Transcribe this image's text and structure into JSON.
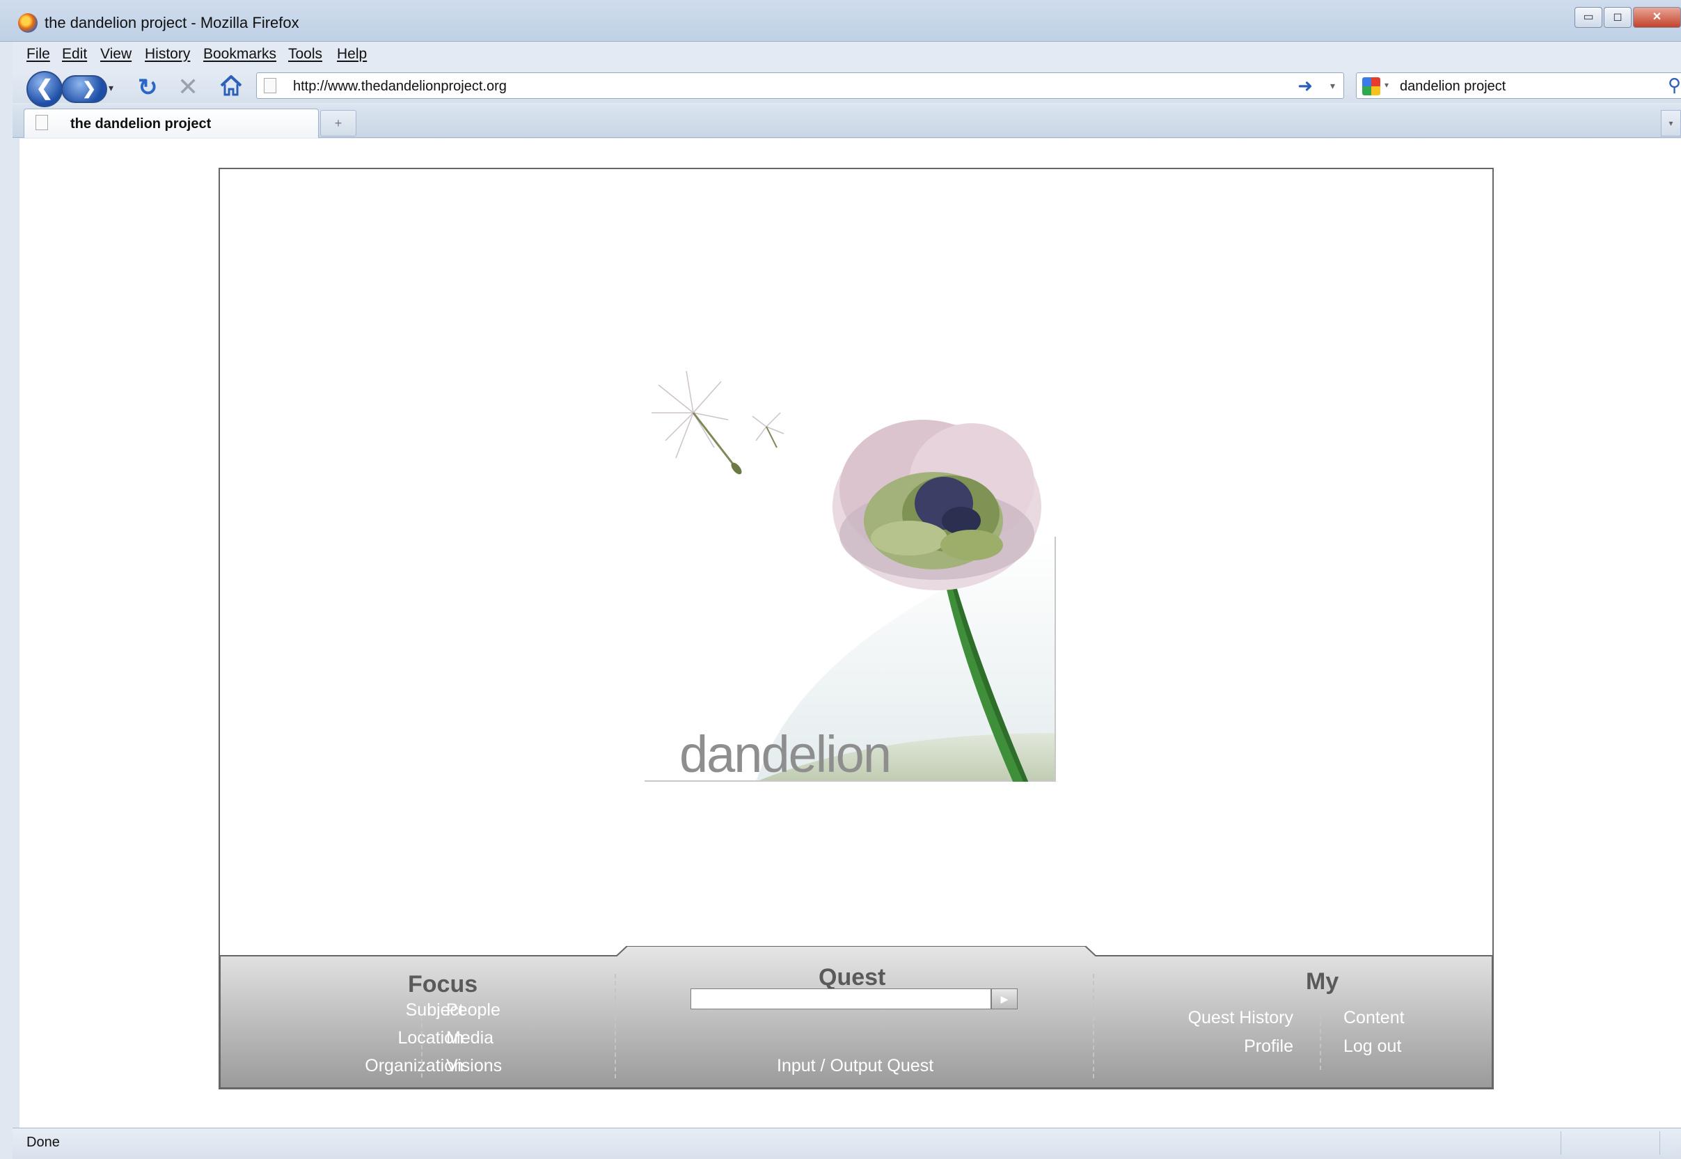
{
  "window": {
    "title": "the dandelion project - Mozilla Firefox",
    "controls": {
      "minimize": "▭",
      "maximize": "◻",
      "close": "✕"
    }
  },
  "menu": [
    "File",
    "Edit",
    "View",
    "History",
    "Bookmarks",
    "Tools",
    "Help"
  ],
  "toolbar": {
    "back_icon": "❮",
    "forward_icon": "❯",
    "dropdown_icon": "▾",
    "reload_icon": "↻",
    "stop_icon": "✕",
    "url": "http://www.thedandelionproject.org",
    "go_icon": "➜",
    "url_dropdown_icon": "▾",
    "search_engine_dropdown": "▾",
    "search_query": "dandelion project",
    "search_icon": "⚲"
  },
  "tabs": {
    "active_label": "the dandelion project",
    "new_tab_icon": "+",
    "list_icon": "▾"
  },
  "page": {
    "hero_title": "dandelion",
    "nav": {
      "focus": {
        "title": "Focus",
        "left": [
          "Subject",
          "Location",
          "Organization"
        ],
        "right": [
          "People",
          "Media",
          "Visions"
        ]
      },
      "quest": {
        "title": "Quest",
        "input_value": "",
        "submit_icon": "▶",
        "link": "Input / Output Quest"
      },
      "my": {
        "title": "My",
        "left": [
          "Quest History",
          "Profile"
        ],
        "right": [
          "Content",
          "Log out"
        ]
      }
    }
  },
  "status": {
    "text": "Done"
  },
  "colors": {
    "panel_gradient_top": "#e6e6e6",
    "panel_gradient_bottom": "#9a9a9a",
    "stem": "#3f8f3a",
    "seed_head": "#dcc4cf"
  }
}
